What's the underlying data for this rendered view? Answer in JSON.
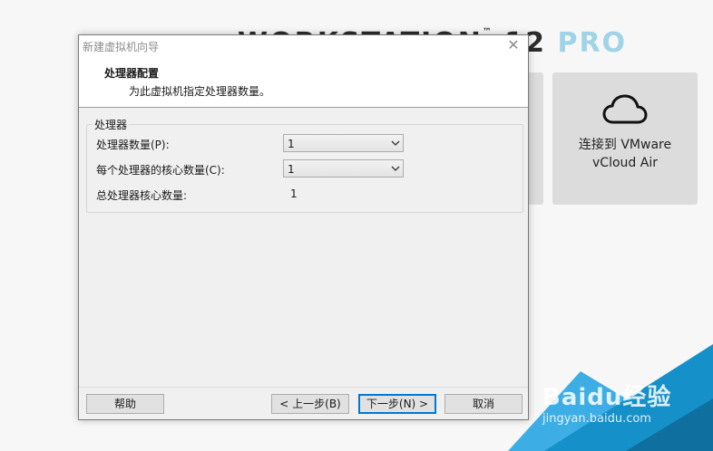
{
  "background": {
    "brand_text": "WORKSTATION",
    "brand_tm": "™",
    "brand_version": "12",
    "brand_pro": "PRO",
    "tile_cloud_label_line1": "连接到 VMware",
    "tile_cloud_label_line2": "vCloud Air",
    "watermark_main": "Baidu经验",
    "watermark_sub": "jingyan.baidu.com",
    "colors": {
      "accent": "#1ba1e2",
      "accent_dark": "#0f6f9f",
      "tile": "#dcdcdc"
    }
  },
  "dialog": {
    "title": "新建虚拟机向导",
    "close_symbol": "✕",
    "header_title": "处理器配置",
    "header_subtitle": "为此虚拟机指定处理器数量。",
    "group_label": "处理器",
    "rows": {
      "processors_label": "处理器数量(P):",
      "processors_value": "1",
      "cores_label": "每个处理器的核心数量(C):",
      "cores_value": "1",
      "total_label": "总处理器核心数量:",
      "total_value": "1"
    },
    "buttons": {
      "help": "帮助",
      "back": "< 上一步(B)",
      "next": "下一步(N) >",
      "cancel": "取消"
    }
  }
}
